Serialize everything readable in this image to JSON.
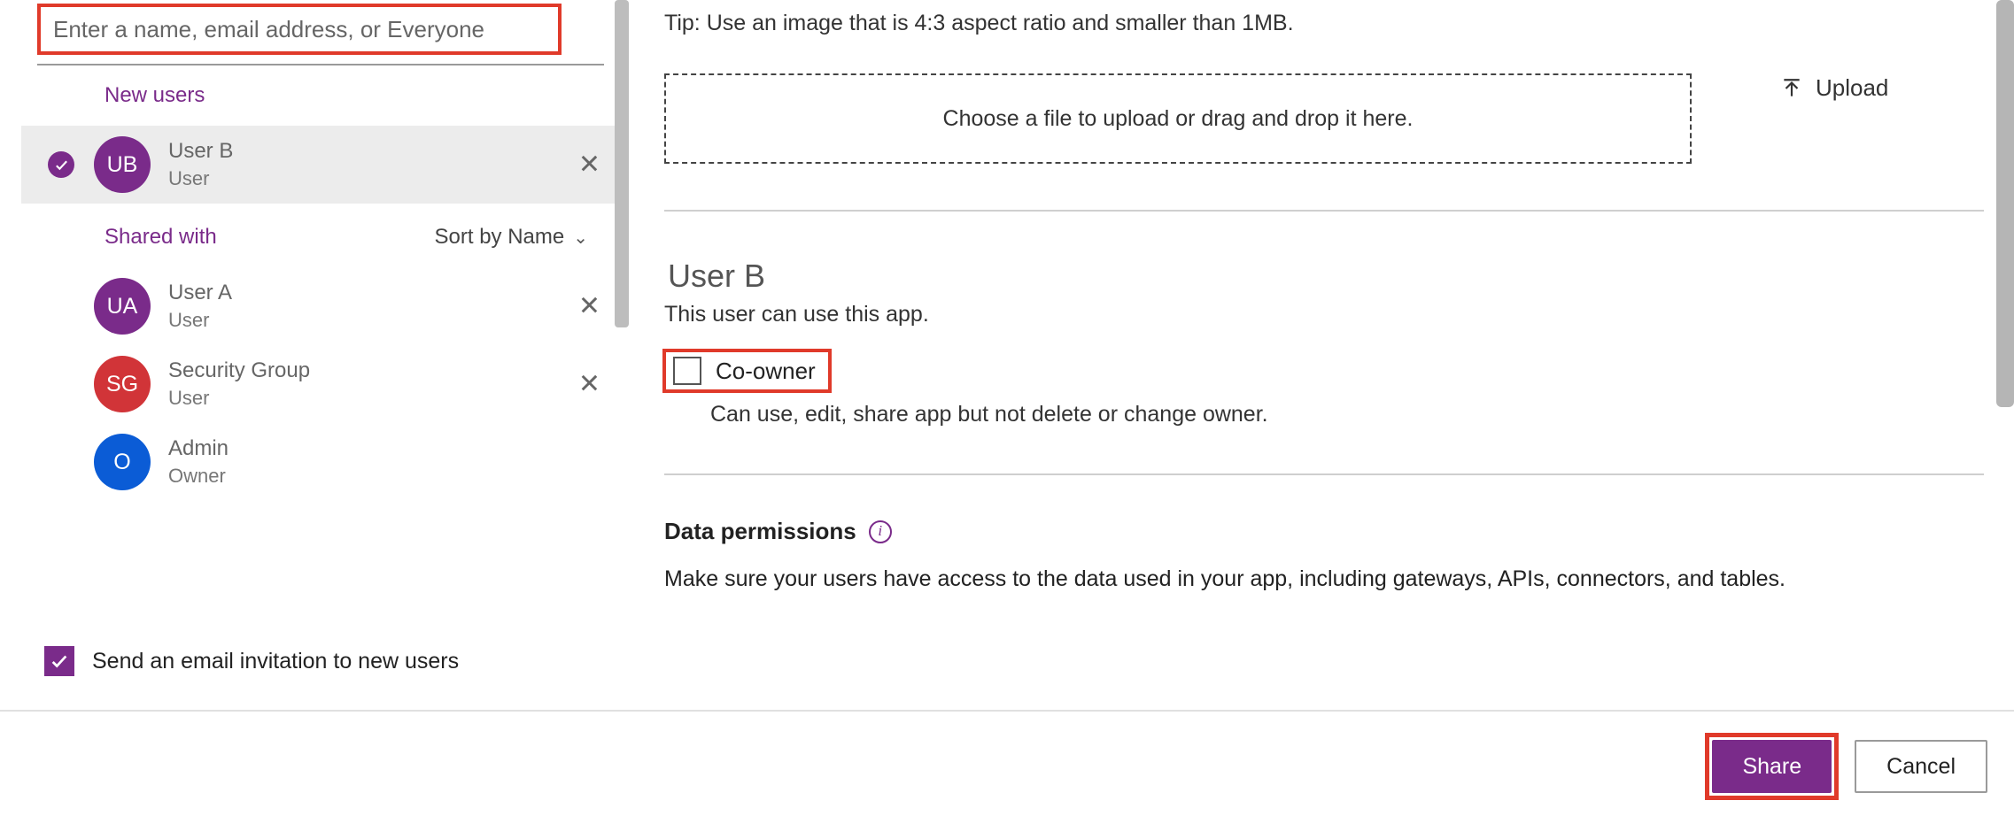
{
  "search": {
    "placeholder": "Enter a name, email address, or Everyone"
  },
  "sections": {
    "new_users_label": "New users",
    "shared_with_label": "Shared with",
    "sort_by_label": "Sort by Name"
  },
  "users": {
    "new": [
      {
        "initials": "UB",
        "name": "User B",
        "role": "User",
        "selected": true,
        "avatar_color": "purple",
        "removable": true
      }
    ],
    "shared": [
      {
        "initials": "UA",
        "name": "User A",
        "role": "User",
        "avatar_color": "purple",
        "removable": true
      },
      {
        "initials": "SG",
        "name": "Security Group",
        "role": "User",
        "avatar_color": "red",
        "removable": true
      },
      {
        "initials": "O",
        "name": "Admin",
        "role": "Owner",
        "avatar_color": "blue",
        "removable": false
      }
    ]
  },
  "email_invite": {
    "label": "Send an email invitation to new users",
    "checked": true
  },
  "upload": {
    "tip": "Tip: Use an image that is 4:3 aspect ratio and smaller than 1MB.",
    "dropzone": "Choose a file to upload or drag and drop it here.",
    "button": "Upload"
  },
  "detail": {
    "title": "User B",
    "subtitle": "This user can use this app.",
    "coowner_label": "Co-owner",
    "coowner_checked": false,
    "coowner_desc": "Can use, edit, share app but not delete or change owner."
  },
  "data_permissions": {
    "title": "Data permissions",
    "body": "Make sure your users have access to the data used in your app, including gateways, APIs, connectors, and tables."
  },
  "footer": {
    "primary": "Share",
    "secondary": "Cancel"
  }
}
